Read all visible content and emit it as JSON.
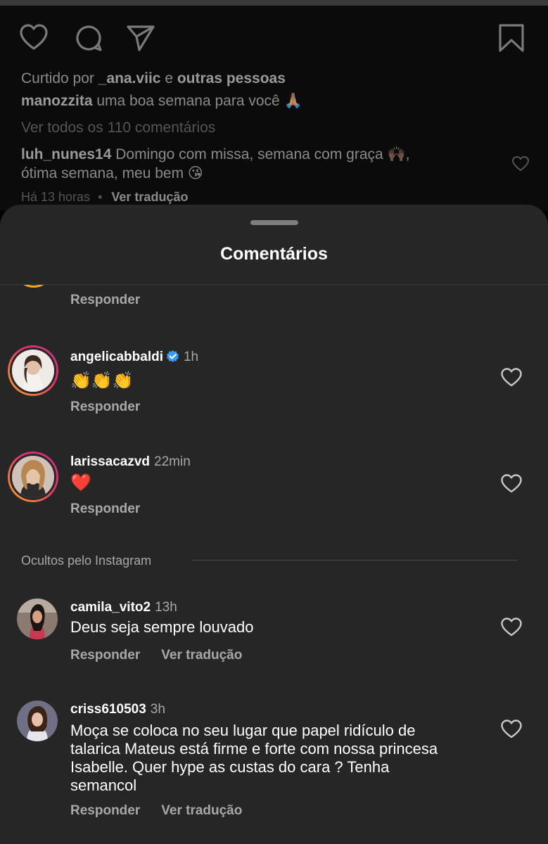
{
  "post": {
    "liked_by_prefix": "Curtido por",
    "liked_by_user": "_ana.viic",
    "liked_by_join": "e",
    "liked_by_others": "outras pessoas",
    "caption_user": "manozzita",
    "caption_text": "uma boa semana para você 🙏🏽",
    "view_all": "Ver todos os 110 comentários",
    "top_comment_user": "luh_nunes14",
    "top_comment_text_1": "Domingo com missa, semana com graça 🙌🏿,",
    "top_comment_text_2": "ótima semana, meu bem 😘",
    "top_comment_time": "Há 13 horas",
    "top_comment_separator": "•",
    "top_comment_translate": "Ver tradução"
  },
  "sheet": {
    "title": "Comentários",
    "partial_reply": "Responder",
    "comments": [
      {
        "user": "angelicabbaldi",
        "time": "1h",
        "verified": true,
        "text": "👏👏👏",
        "reply": "Responder"
      },
      {
        "user": "larissacazvd",
        "time": "22min",
        "verified": false,
        "text": "❤️",
        "reply": "Responder"
      }
    ],
    "hidden_section_label": "Ocultos pelo Instagram",
    "hidden_comments": [
      {
        "user": "camila_vito2",
        "time": "13h",
        "text": "Deus seja sempre louvado",
        "reply": "Responder",
        "translate": "Ver tradução"
      },
      {
        "user": "criss610503",
        "time": "3h",
        "text_lines": [
          "Moça se coloca no seu lugar que papel ridículo de",
          "talarica Mateus está firme e forte com nossa princesa",
          "Isabelle. Quer hype as custas do cara ? Tenha",
          "semancol"
        ],
        "reply": "Responder",
        "translate": "Ver tradução"
      }
    ]
  },
  "icons": {
    "like": "heart-icon",
    "comment": "comment-bubble-icon",
    "share": "paper-plane-icon",
    "save": "bookmark-icon",
    "verified": "verified-badge-icon"
  },
  "colors": {
    "sheet_bg": "#262626",
    "verified_blue": "#3897f0",
    "heart_red": "#ed4956"
  }
}
